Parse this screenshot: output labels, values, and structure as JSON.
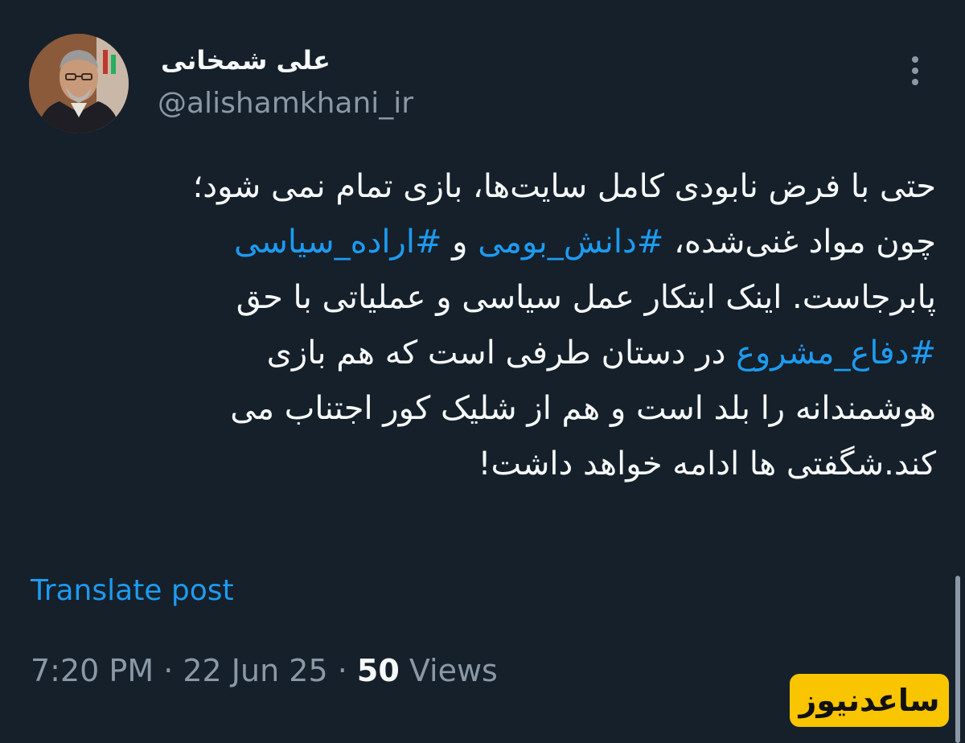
{
  "author": {
    "display_name": "علی شمخانی",
    "handle": "@alishamkhani_ir",
    "avatar_alt": "profile photo"
  },
  "tweet": {
    "lines": [
      [
        {
          "text": "حتی با فرض نابودی کامل سایت‌ها، بازی تمام نمی شود؛",
          "hashtag": false
        }
      ],
      [
        {
          "text": "چون مواد غنی‌شده، ",
          "hashtag": false
        },
        {
          "text": "#دانش_بومی",
          "hashtag": true
        },
        {
          "text": " و ",
          "hashtag": false
        },
        {
          "text": "#اراده_سیاسی",
          "hashtag": true
        }
      ],
      [
        {
          "text": "پابرجاست. اینک ابتکار عمل سیاسی و عملیاتی با حق",
          "hashtag": false
        }
      ],
      [
        {
          "text": "#دفاع_مشروع",
          "hashtag": true
        },
        {
          "text": " در دستان طرفی است که هم بازی",
          "hashtag": false
        }
      ],
      [
        {
          "text": "هوشمندانه را بلد است و هم از شلیک کور اجتناب می",
          "hashtag": false
        }
      ],
      [
        {
          "text": "کند.شگفتی ها ادامه خواهد داشت!",
          "hashtag": false
        }
      ]
    ]
  },
  "translate_label": "Translate post",
  "meta": {
    "time": "7:20 PM",
    "separator": " · ",
    "date": "22 Jun 25",
    "views_count": "50",
    "views_label": " Views"
  },
  "watermark": "ساعدنیوز",
  "colors": {
    "background": "#15202b",
    "text": "#f7f9f9",
    "muted": "#8b98a5",
    "accent": "#1d9bf0",
    "watermark_bg": "#f9c400"
  },
  "icons": {
    "more": "more-vertical-icon"
  }
}
